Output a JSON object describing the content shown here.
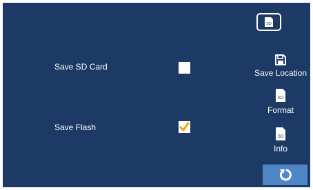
{
  "options": [
    {
      "label": "Save SD Card",
      "checked": false
    },
    {
      "label": "Save Flash",
      "checked": true
    }
  ],
  "top_icon": {
    "name": "sd-card-icon",
    "text": "SD"
  },
  "side_menu": {
    "save_location": {
      "label": "Save Location",
      "icon": "floppy-disk-icon"
    },
    "format": {
      "label": "Format",
      "icon": "sd-card-format-icon",
      "icon_text": "SD",
      "badge": "×"
    },
    "info": {
      "label": "Info",
      "icon": "sd-card-info-icon",
      "icon_text": "SD"
    }
  },
  "back_button": {
    "icon": "undo-arrow-icon"
  },
  "colors": {
    "background": "#1d3a66",
    "back_button": "#4f86c6",
    "checkmark": "#f5a300",
    "text": "#ffffff"
  }
}
